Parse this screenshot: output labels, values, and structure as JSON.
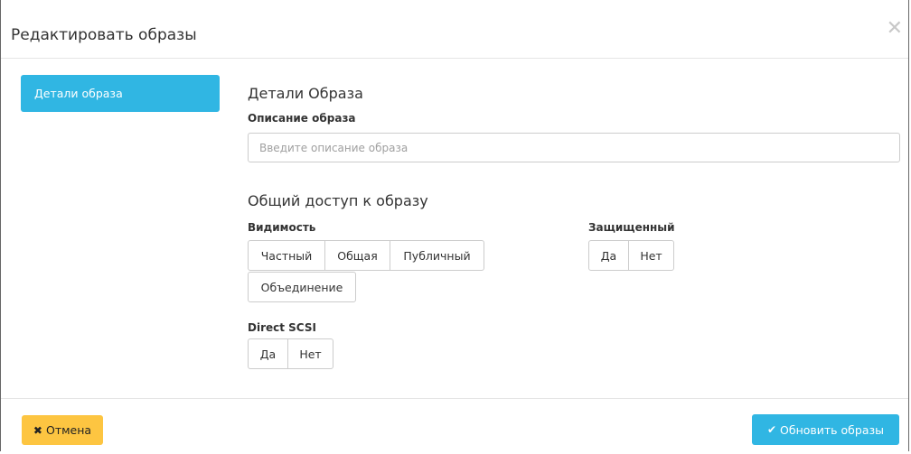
{
  "modal": {
    "title": "Редактировать образы",
    "close_icon": "close-icon"
  },
  "sidebar": {
    "tab_label": "Детали образа"
  },
  "details": {
    "section_title": "Детали Образа",
    "description_label": "Описание образа",
    "description_placeholder": "Введите описание образа",
    "description_value": ""
  },
  "access": {
    "section_title": "Общий доступ к образу",
    "visibility_label": "Видимость",
    "visibility_options": [
      "Частный",
      "Общая",
      "Публичный",
      "Объединение"
    ],
    "protected_label": "Защищенный",
    "protected_options": [
      "Да",
      "Нет"
    ],
    "direct_scsi_label": "Direct SCSI",
    "direct_scsi_options": [
      "Да",
      "Нет"
    ]
  },
  "footer": {
    "cancel_label": "Отмена",
    "cancel_icon": "times-icon",
    "submit_label": "Обновить образы",
    "submit_icon": "check-icon"
  },
  "colors": {
    "primary": "#30b6e3",
    "warning": "#fdc541"
  }
}
